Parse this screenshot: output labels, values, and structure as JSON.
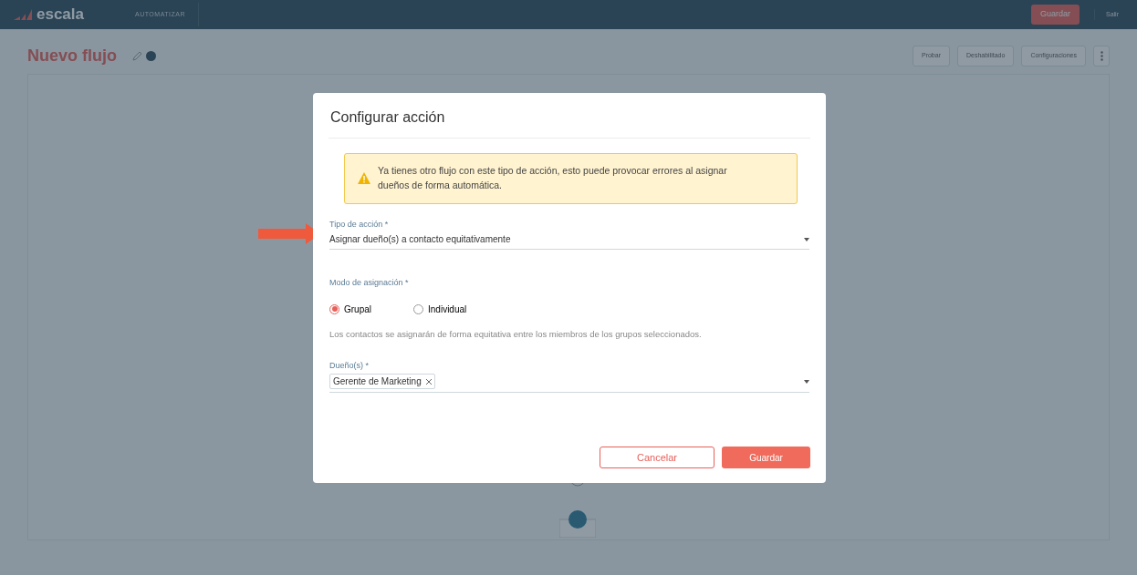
{
  "app": {
    "logo": "escala",
    "nav_items": [
      {
        "label": "AUTOMATIZAR",
        "selected": false
      }
    ],
    "save_button": "Guardar",
    "logout": "Salir"
  },
  "page": {
    "title": "Nuevo flujo",
    "test_button": "Probar",
    "status_dropdown": "Deshabilitado",
    "settings_button": "Configuraciones"
  },
  "modal": {
    "title": "Configurar acción",
    "alert": "Ya tienes otro flujo con este tipo de acción, esto puede provocar errores al asignar dueños de forma automática.",
    "action_type": {
      "label": "Tipo de acción *",
      "value": "Asignar dueño(s) a contacto equitativamente"
    },
    "assignment_mode": {
      "label": "Modo de asignación *",
      "options": [
        {
          "label": "Grupal",
          "selected": true
        },
        {
          "label": "Individual",
          "selected": false
        }
      ],
      "help": "Los contactos se asignarán de forma equitativa entre los miembros de los grupos seleccionados."
    },
    "owners": {
      "label": "Dueño(s) *",
      "tags": [
        {
          "label": "Gerente de Marketing"
        }
      ]
    },
    "cancel_button": "Cancelar",
    "save_button": "Guardar"
  }
}
